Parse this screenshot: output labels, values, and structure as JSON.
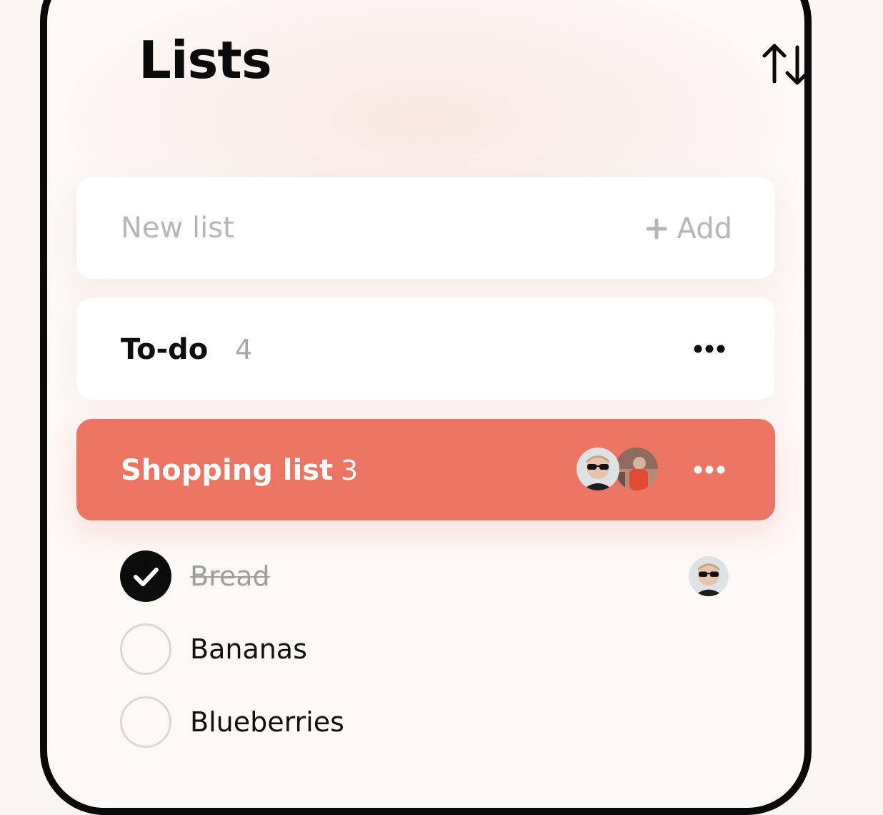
{
  "header": {
    "title": "Lists"
  },
  "new_list": {
    "placeholder": "New list",
    "add_label": "Add"
  },
  "lists": [
    {
      "name": "To-do",
      "count": "4"
    },
    {
      "name": "Shopping list",
      "count": "3"
    }
  ],
  "items": [
    {
      "label": "Bread",
      "checked": true
    },
    {
      "label": "Bananas",
      "checked": false
    },
    {
      "label": "Blueberries",
      "checked": false
    }
  ],
  "colors": {
    "accent": "#ec7462",
    "background": "#fcf8f5",
    "text": "#0b0b0b",
    "muted": "#b6b6b6"
  },
  "icons": [
    "sort-icon",
    "plus-icon",
    "more-icon",
    "check-icon"
  ]
}
